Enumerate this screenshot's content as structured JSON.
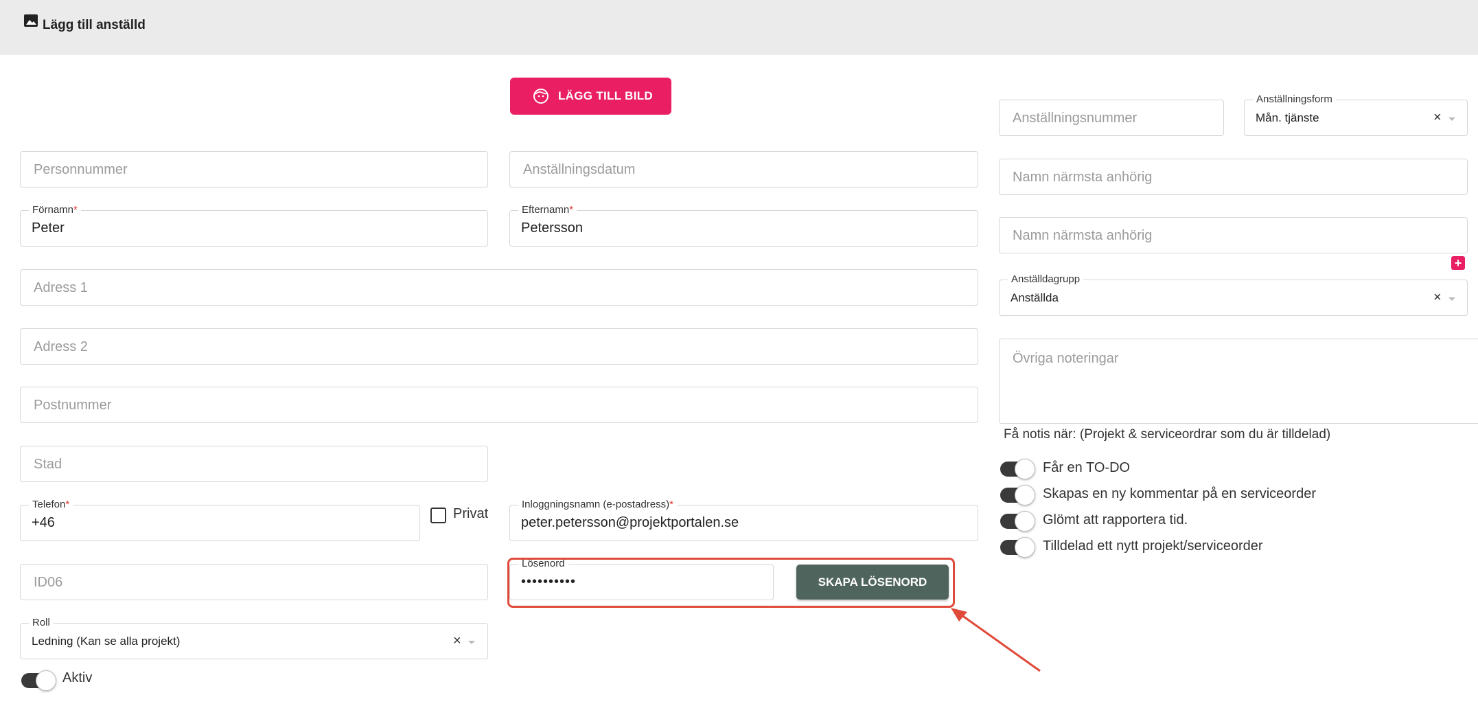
{
  "header": {
    "title": "Lägg till anställd",
    "icon": "image-icon"
  },
  "add_image_button": {
    "label": "LÄGG TILL BILD",
    "icon": "face-icon",
    "color": "#e91e63"
  },
  "fields": {
    "personnummer": {
      "placeholder": "Personnummer"
    },
    "anstallningsdatum": {
      "placeholder": "Anställningsdatum"
    },
    "fornamn": {
      "label": "Förnamn",
      "required": "*",
      "value": "Peter"
    },
    "efternamn": {
      "label": "Efternamn",
      "required": "*",
      "value": "Petersson"
    },
    "adress1": {
      "placeholder": "Adress 1"
    },
    "adress2": {
      "placeholder": "Adress 2"
    },
    "postnummer": {
      "placeholder": "Postnummer"
    },
    "stad": {
      "placeholder": "Stad"
    },
    "telefon": {
      "label": "Telefon",
      "required": "*",
      "value": "+46"
    },
    "privat": {
      "label": "Privat",
      "checked": false
    },
    "inloggningsnamn": {
      "label": "Inloggningsnamn (e-postadress)",
      "required": "*",
      "value": "peter.petersson@projektportalen.se"
    },
    "id06": {
      "placeholder": "ID06"
    },
    "losenord": {
      "label": "Lösenord",
      "value": "••••••••••"
    },
    "roll": {
      "label": "Roll",
      "value": "Ledning (Kan se alla projekt)",
      "clear": "×"
    },
    "aktiv": {
      "label": "Aktiv",
      "on": true
    },
    "anstallningsnummer": {
      "placeholder": "Anställningsnummer"
    },
    "anstallningsform": {
      "label": "Anställningsform",
      "value": "Mån. tjänste",
      "clear": "×"
    },
    "anhorig1": {
      "placeholder": "Namn närmsta anhörig"
    },
    "anhorig2": {
      "placeholder": "Namn närmsta anhörig"
    },
    "anstalldagrupp": {
      "label": "Anställdagrupp",
      "value": "Anställda",
      "clear": "×"
    },
    "ovriga": {
      "placeholder": "Övriga noteringar"
    }
  },
  "add_relative_button": {
    "label": "+"
  },
  "create_password_button": {
    "label": "SKAPA LÖSENORD",
    "color": "#4f645c"
  },
  "notifications": {
    "heading": "Få notis när: (Projekt & serviceordrar som du är tilldelad)",
    "items": [
      {
        "label": "Får en TO-DO",
        "on": true
      },
      {
        "label": "Skapas en ny kommentar på en serviceorder",
        "on": true
      },
      {
        "label": "Glömt att rapportera tid.",
        "on": true
      },
      {
        "label": "Tilldelad ett nytt projekt/serviceorder",
        "on": true
      }
    ]
  },
  "annotation": {
    "highlight_color": "#e04a3a"
  }
}
